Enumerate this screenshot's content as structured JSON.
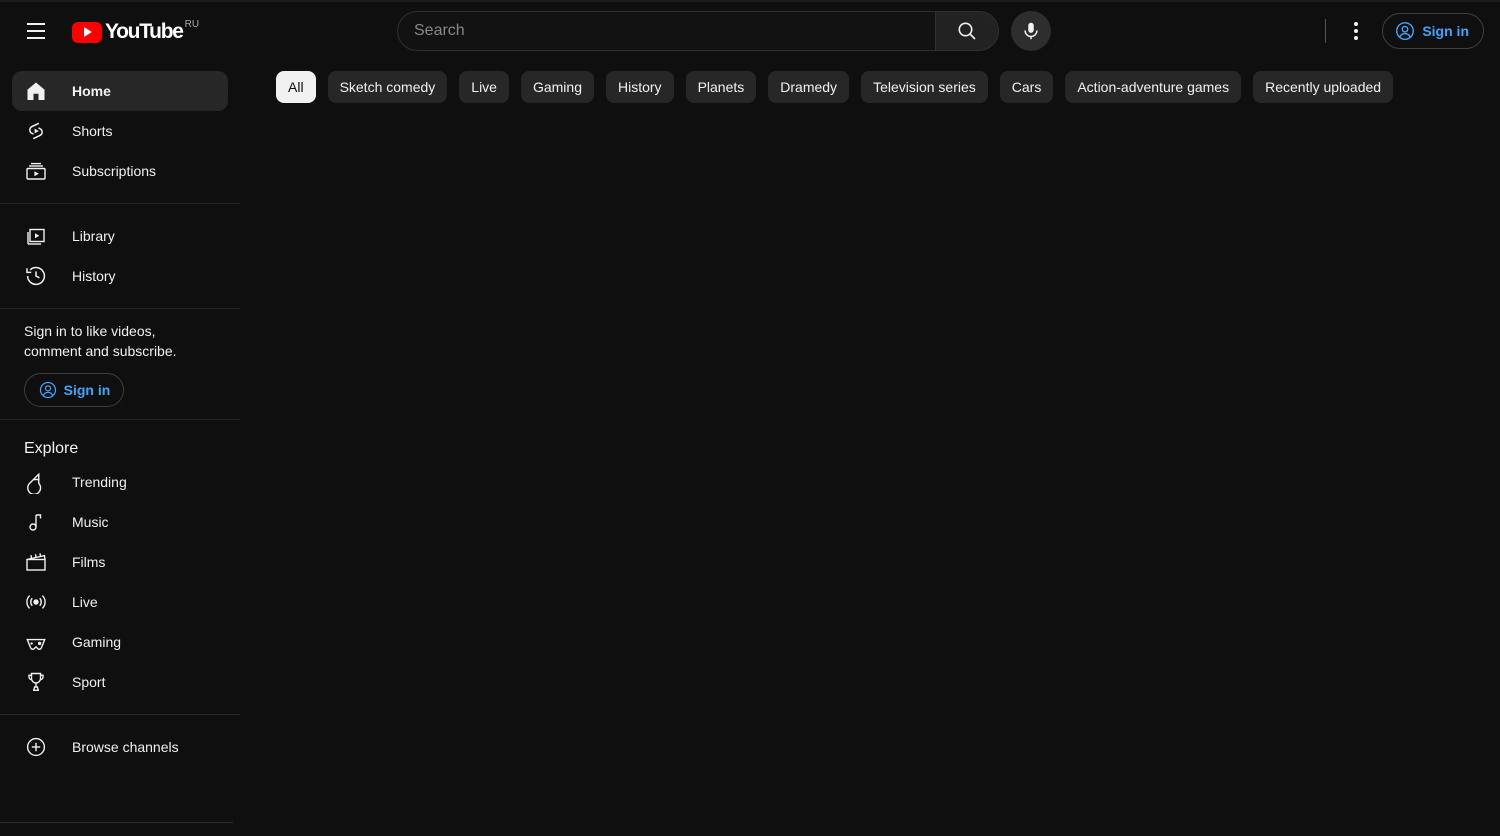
{
  "header": {
    "menu_icon": "hamburger-menu-icon",
    "logo_text": "YouTube",
    "logo_country": "RU",
    "search": {
      "placeholder": "Search",
      "value": "",
      "button_icon": "search-icon"
    },
    "mic_icon": "microphone-icon",
    "kebab_icon": "more-vertical-icon",
    "signin_label": "Sign in",
    "signin_icon": "account-circle-icon"
  },
  "sidebar": {
    "primary": [
      {
        "label": "Home",
        "icon": "home-icon",
        "active": true
      },
      {
        "label": "Shorts",
        "icon": "shorts-icon",
        "active": false
      },
      {
        "label": "Subscriptions",
        "icon": "subscriptions-icon",
        "active": false
      }
    ],
    "secondary": [
      {
        "label": "Library",
        "icon": "library-icon",
        "active": false
      },
      {
        "label": "History",
        "icon": "history-icon",
        "active": false
      }
    ],
    "signin_promo": {
      "text": "Sign in to like videos, comment and subscribe.",
      "button_label": "Sign in",
      "button_icon": "account-circle-icon"
    },
    "explore": {
      "title": "Explore",
      "items": [
        {
          "label": "Trending",
          "icon": "trending-icon"
        },
        {
          "label": "Music",
          "icon": "music-note-icon"
        },
        {
          "label": "Films",
          "icon": "film-clapperboard-icon"
        },
        {
          "label": "Live",
          "icon": "live-broadcast-icon"
        },
        {
          "label": "Gaming",
          "icon": "gamepad-icon"
        },
        {
          "label": "Sport",
          "icon": "trophy-icon"
        }
      ]
    },
    "browse": {
      "label": "Browse channels",
      "icon": "plus-circle-icon"
    }
  },
  "chips": [
    {
      "label": "All",
      "selected": true
    },
    {
      "label": "Sketch comedy",
      "selected": false
    },
    {
      "label": "Live",
      "selected": false
    },
    {
      "label": "Gaming",
      "selected": false
    },
    {
      "label": "History",
      "selected": false
    },
    {
      "label": "Planets",
      "selected": false
    },
    {
      "label": "Dramedy",
      "selected": false
    },
    {
      "label": "Television series",
      "selected": false
    },
    {
      "label": "Cars",
      "selected": false
    },
    {
      "label": "Action-adventure games",
      "selected": false
    },
    {
      "label": "Recently uploaded",
      "selected": false
    }
  ],
  "colors": {
    "background": "#0f0f0f",
    "brand_red": "#ff0000",
    "accent_blue": "#3ea6ff",
    "chip_bg": "#272727",
    "chip_selected_bg": "#f1f1f1",
    "text_primary": "#f1f1f1"
  }
}
